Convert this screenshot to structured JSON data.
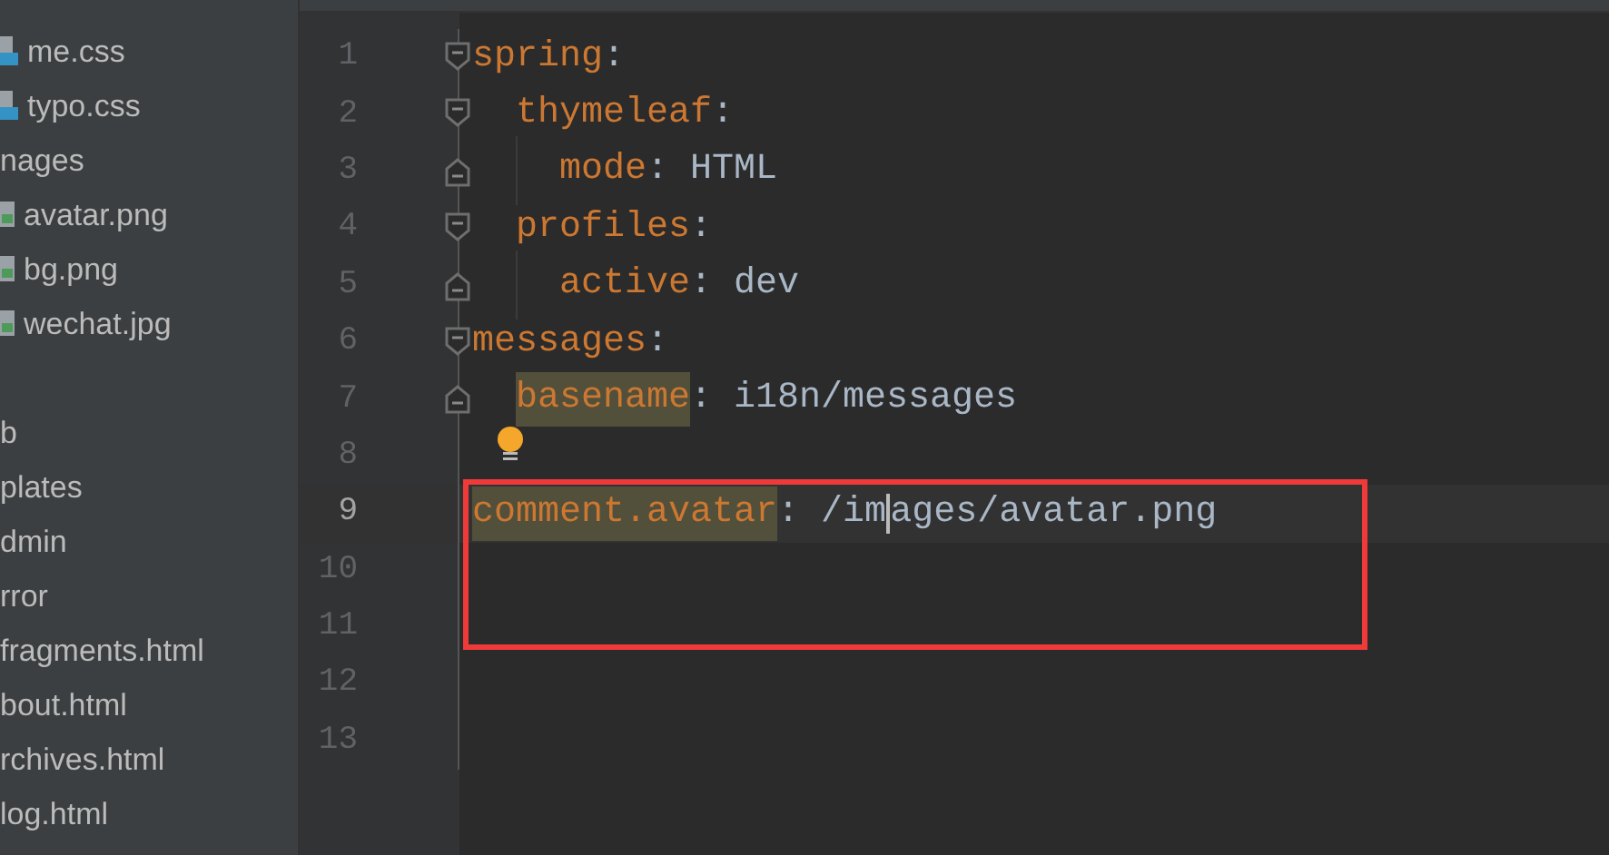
{
  "sidebar": {
    "items": [
      {
        "kind": "css",
        "label": "me.css"
      },
      {
        "kind": "css",
        "label": "typo.css"
      },
      {
        "kind": "plain",
        "label": "nages"
      },
      {
        "kind": "image",
        "label": "avatar.png"
      },
      {
        "kind": "image",
        "label": "bg.png"
      },
      {
        "kind": "image",
        "label": "wechat.jpg"
      },
      {
        "kind": "gap"
      },
      {
        "kind": "plain",
        "label": "b"
      },
      {
        "kind": "plain",
        "label": "plates"
      },
      {
        "kind": "plain",
        "label": "dmin"
      },
      {
        "kind": "plain",
        "label": "rror"
      },
      {
        "kind": "plain",
        "label": "fragments.html"
      },
      {
        "kind": "plain",
        "label": "bout.html"
      },
      {
        "kind": "plain",
        "label": "rchives.html"
      },
      {
        "kind": "plain",
        "label": "log.html"
      }
    ]
  },
  "editor": {
    "lines": [
      {
        "number": "1",
        "key": "spring",
        "separator": ":",
        "kind": "fold_start",
        "highlighted": false,
        "selected": false,
        "children": [
          {
            "number": "2",
            "key": "thymeleaf",
            "separator": ":",
            "kind": "fold_start",
            "highlighted": false,
            "selected": false,
            "children": [
              {
                "number": "3",
                "key": "mode",
                "separator": ":",
                "value": "HTML",
                "kind": "fold_end",
                "highlighted": false,
                "selected": false
              }
            ]
          },
          {
            "number": "4",
            "key": "profiles",
            "separator": ":",
            "kind": "fold_start",
            "highlighted": false,
            "selected": false,
            "children": [
              {
                "number": "5",
                "key": "active",
                "separator": ":",
                "value": "dev",
                "kind": "fold_end",
                "highlighted": false,
                "selected": false
              }
            ]
          }
        ]
      },
      {
        "number": "6",
        "key": "messages",
        "separator": ":",
        "kind": "fold_start",
        "highlighted": false,
        "selected": false,
        "children": [
          {
            "number": "7",
            "key": "basename",
            "separator": ":",
            "value": "i18n/messages",
            "kind": "fold_end",
            "highlighted": true,
            "selected": false
          }
        ]
      },
      {
        "number": "8",
        "kind": "plain",
        "intention_bulb": true,
        "selected": false
      },
      {
        "number": "9",
        "kind": "plain",
        "key": "comment.avatar",
        "separator": ":",
        "value_before_caret": "/im",
        "value_after_caret": "ages/avatar.png",
        "highlighted": true,
        "selected": true
      },
      {
        "number": "10",
        "kind": "plain",
        "selected": false
      },
      {
        "number": "11",
        "kind": "plain",
        "selected": false
      },
      {
        "number": "12",
        "kind": "plain",
        "selected": false
      },
      {
        "number": "13",
        "kind": "plain",
        "selected": false
      }
    ]
  }
}
